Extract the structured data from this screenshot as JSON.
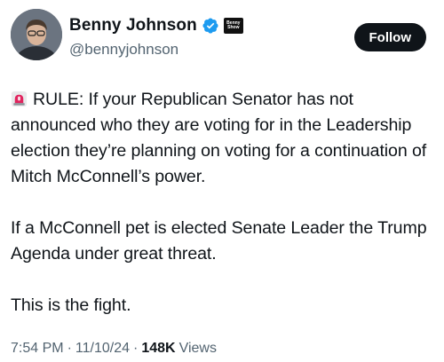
{
  "header": {
    "display_name": "Benny Johnson",
    "handle": "@bennyjohnson",
    "affiliation_badge": "Benny\nShow",
    "follow_label": "Follow"
  },
  "tweet": {
    "paragraphs": [
      "RULE: If your Republican Senator has not announced who they are voting for in the Leadership election they’re planning on voting for a continuation of Mitch McConnell’s power.",
      "If a McConnell pet is elected Senate Leader the Trump Agenda under great threat.",
      "This is the fight."
    ]
  },
  "meta": {
    "time": "7:54 PM",
    "date": "11/10/24",
    "separator": "·",
    "views_count": "148K",
    "views_label": "Views"
  },
  "colors": {
    "text": "#0f1419",
    "secondary": "#536471",
    "verified": "#1d9bf0",
    "button_bg": "#0f1419"
  },
  "icons": {
    "verified": "verified-badge-icon",
    "siren": "police-siren-icon"
  }
}
